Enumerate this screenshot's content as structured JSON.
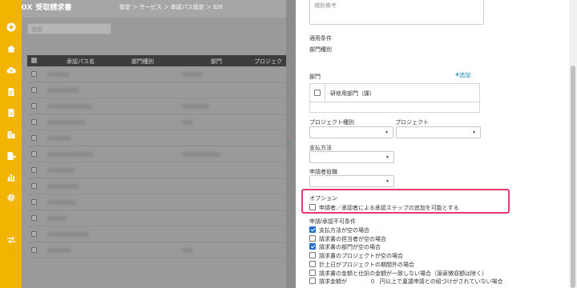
{
  "app": {
    "logo_text": "invox",
    "logo_sub": "受取請求書"
  },
  "breadcrumb": "設定 ＞ サービス ＞ 承認パス設定 ＞ 328",
  "background_list": {
    "search_placeholder": "名前",
    "columns": [
      "承認パス名",
      "部門種別",
      "部門",
      "プロジェク"
    ],
    "row_count": 12
  },
  "rail_icons": [
    "plus-circle-icon",
    "home-icon",
    "cloud-upload-icon",
    "document-icon",
    "file-icon",
    "building-icon",
    "document-arrow-icon",
    "chart-icon",
    "gear-icon",
    "transfer-icon"
  ],
  "panel": {
    "textarea_placeholder": "補助備考",
    "conditions_title": "適用条件",
    "dept_type_label": "部門種別",
    "dept_label": "部門",
    "add_label": "追加",
    "dept_item": "研修用部門（課）",
    "project_type_label": "プロジェクト種別",
    "project_label": "プロジェクト",
    "payment_method_label": "支払方法",
    "applicant_role_label": "申請者役職",
    "options_title": "オプション",
    "option_item": "申請者／承認者による承認ステップの追加を可能とする",
    "restriction_title": "申請/承認不可条件",
    "restrictions": [
      {
        "label": "支払方法が空の場合",
        "checked": true
      },
      {
        "label": "請求書の担当者が空の場合",
        "checked": false
      },
      {
        "label": "請求書の部門が空の場合",
        "checked": true
      },
      {
        "label": "請求書のプロジェクトが空の場合",
        "checked": false
      },
      {
        "label": "計上日がプロジェクトの期間外の場合",
        "checked": false
      },
      {
        "label": "請求書の金額と仕訳の金額が一致しない場合（源泉徴収額は除く）",
        "checked": false
      },
      {
        "label": "請求金額が 　　　　0　円以上で稟議申請との紐づけがされていない場合",
        "checked": false
      }
    ]
  },
  "colors": {
    "accent_yellow": "#f3b400",
    "link_blue": "#1a8cb6",
    "highlight_pink": "#e8376b",
    "check_blue": "#1f6fd1"
  }
}
